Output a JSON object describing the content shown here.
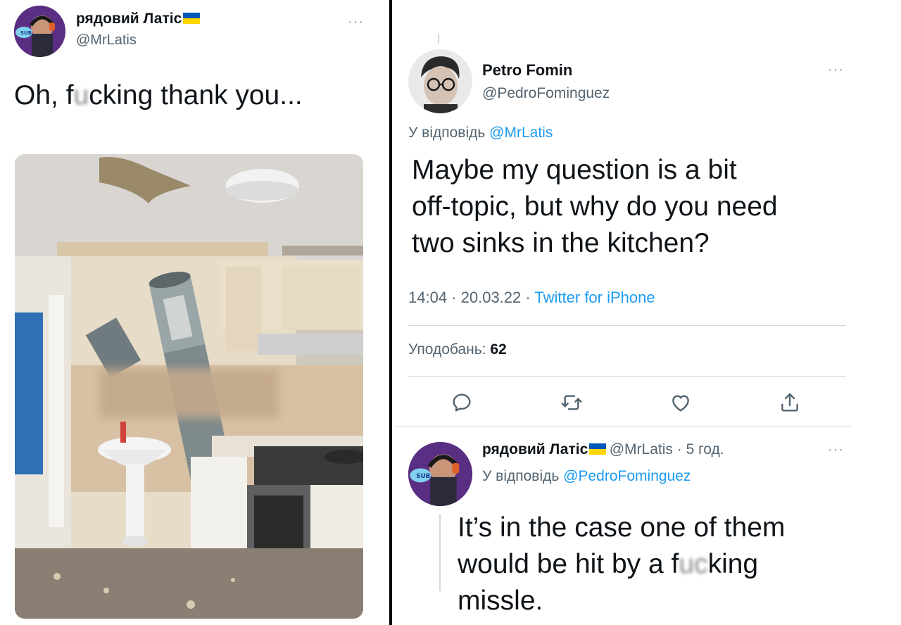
{
  "left_tweet": {
    "author_name": "рядовий Латіс",
    "author_handle": "@MrLatis",
    "text_before": "Oh, f",
    "text_censored": "u",
    "text_after": "cking thank you...",
    "image_description": "kitchen with missile through ceiling",
    "more_icon": "more-dots-icon"
  },
  "right_tweet": {
    "author_name": "Petro Fomin",
    "author_handle": "@PedroFominguez",
    "reply_prefix": "У відповідь",
    "reply_to": "@MrLatis",
    "text": "Maybe my question is a bit off-topic, but why do you need two sinks in the kitchen?",
    "text_lines": [
      "Maybe my question is a bit",
      "off-topic, but why do you need",
      "two sinks in the kitchen?"
    ],
    "time": "14:04",
    "date": "20.03.22",
    "source": "Twitter for iPhone",
    "likes_label": "Уподобань:",
    "likes_count": "62",
    "actions": [
      "reply-icon",
      "retweet-icon",
      "like-icon",
      "share-icon"
    ]
  },
  "reply_tweet": {
    "author_name": "рядовий Латіс",
    "author_handle": "@MrLatis",
    "time_ago": "5 год.",
    "reply_prefix": "У відповідь",
    "reply_to": "@PedroFominguez",
    "line1": "It’s in the case one of them",
    "line2_before": "would be hit by a f",
    "line2_censored": "uc",
    "line2_after": "king",
    "line3": "missle."
  },
  "colors": {
    "accent": "#1d9bf0",
    "flag_blue": "#0057b7",
    "flag_yellow": "#ffd700",
    "muted": "#536471"
  }
}
